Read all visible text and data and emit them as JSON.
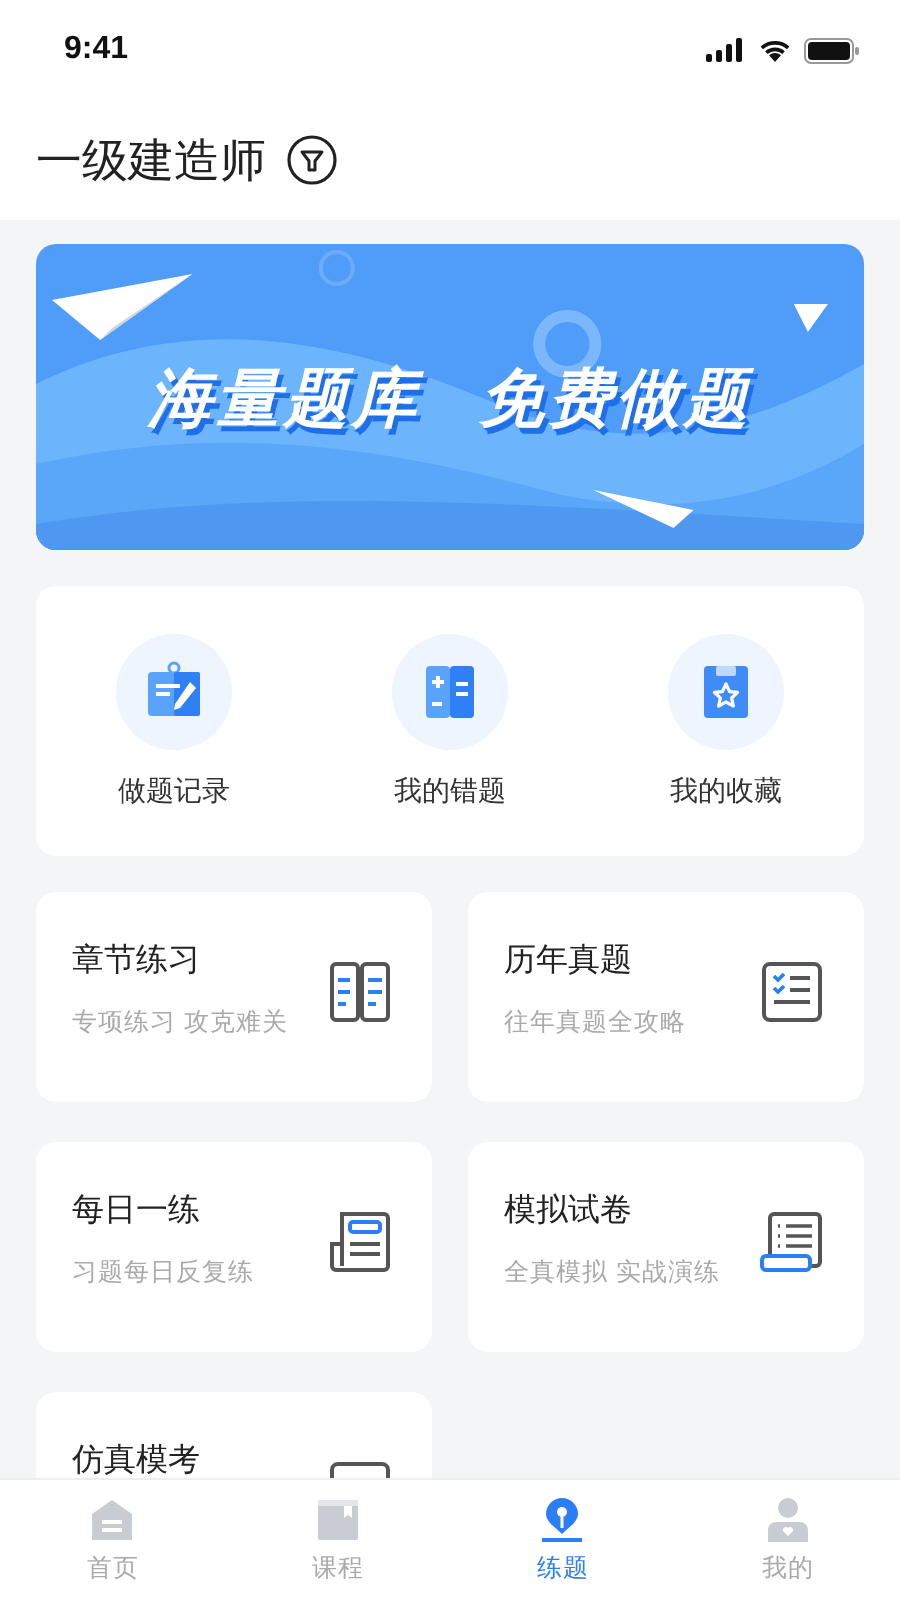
{
  "status_bar": {
    "time": "9:41"
  },
  "header": {
    "title": "一级建造师"
  },
  "banner": {
    "headline": "海量题库",
    "subline": "免费做题"
  },
  "shortcuts": [
    {
      "kind": "record",
      "label": "做题记录"
    },
    {
      "kind": "mistakes",
      "label": "我的错题"
    },
    {
      "kind": "favorites",
      "label": "我的收藏"
    }
  ],
  "modules": [
    {
      "kind": "chapter",
      "title": "章节练习",
      "subtitle": "专项练习 攻克难关"
    },
    {
      "kind": "past",
      "title": "历年真题",
      "subtitle": "往年真题全攻略"
    },
    {
      "kind": "daily",
      "title": "每日一练",
      "subtitle": "习题每日反复练"
    },
    {
      "kind": "mock",
      "title": "模拟试卷",
      "subtitle": "全真模拟 实战演练"
    },
    {
      "kind": "exam",
      "title": "仿真模考"
    }
  ],
  "tab_bar": [
    {
      "kind": "home",
      "label": "首页",
      "selected": false
    },
    {
      "kind": "course",
      "label": "课程",
      "selected": false
    },
    {
      "kind": "practice",
      "label": "练题",
      "selected": true
    },
    {
      "kind": "me",
      "label": "我的",
      "selected": false
    }
  ]
}
